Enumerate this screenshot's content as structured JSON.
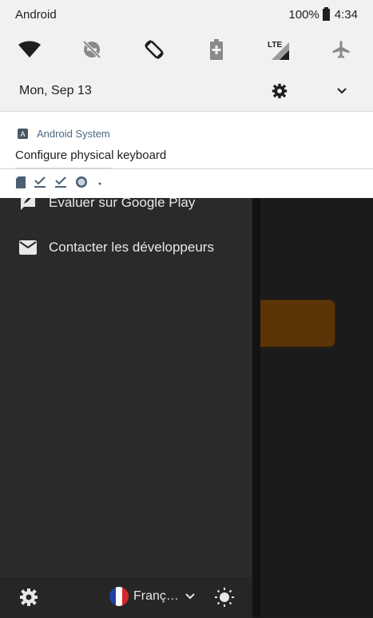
{
  "status_bar": {
    "carrier": "Android",
    "battery_percent": "100%",
    "time": "4:34"
  },
  "quick_settings": {
    "tiles": [
      "wifi-icon",
      "dnd-off-icon",
      "auto-rotate-icon",
      "battery-saver-icon",
      "lte-signal-icon",
      "airplane-mode-icon"
    ]
  },
  "shade": {
    "date": "Mon, Sep 13"
  },
  "notification": {
    "app_letter": "A",
    "app_name": "Android System",
    "title": "Configure physical keyboard"
  },
  "drawer": {
    "items": [
      {
        "label": "Évaluer sur Google Play",
        "icon": "rate-review-icon"
      },
      {
        "label": "Contacter les développeurs",
        "icon": "mail-icon"
      }
    ],
    "bottom": {
      "language": "Franç…",
      "flag_colors": [
        "#1f3fa8",
        "#ffffff",
        "#d8262b"
      ]
    }
  },
  "colors": {
    "accent_button": "#5b3507",
    "drawer_bg": "#2a2a2a",
    "shade_bg": "#f1f1f1"
  }
}
